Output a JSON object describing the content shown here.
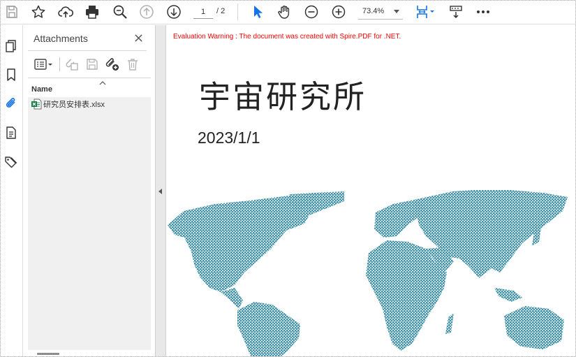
{
  "toolbar": {
    "page_current": "1",
    "page_total": "/ 2",
    "zoom": "73.4%",
    "accent_color": "#1473e6"
  },
  "sidebar_rail": {
    "items": [
      "pages-icon",
      "bookmark-icon",
      "attachment-icon",
      "document-properties-icon",
      "tags-icon"
    ],
    "active": "attachment-icon"
  },
  "attachments": {
    "title": "Attachments",
    "column_name": "Name",
    "files": [
      {
        "name": "研究员安排表.xlsx",
        "icon": "excel-file-icon"
      }
    ]
  },
  "document": {
    "warning": "Evaluation Warning : The document was created with Spire.PDF for .NET.",
    "title": "宇宙研究所",
    "date": "2023/1/1",
    "map_color": "#3f93ad",
    "warning_color": "#ff0000"
  }
}
